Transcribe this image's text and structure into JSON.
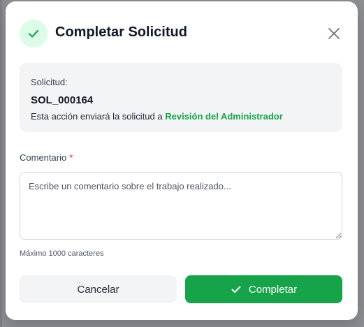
{
  "modal": {
    "title": "Completar Solicitud",
    "accent_color": "#16a34a",
    "header_icon": "check-icon",
    "close_icon": "close-icon"
  },
  "info": {
    "label": "Solicitud:",
    "request_id": "SOL_000164",
    "description_prefix": "Esta acción enviará la solicitud a",
    "target": "Revisión del Administrador"
  },
  "comment": {
    "label": "Comentario",
    "required_marker": "*",
    "placeholder": "Escribe un comentario sobre el trabajo realizado...",
    "value": "",
    "hint": "Máximo 1000 caracteres"
  },
  "buttons": {
    "cancel_label": "Cancelar",
    "complete_label": "Completar"
  }
}
